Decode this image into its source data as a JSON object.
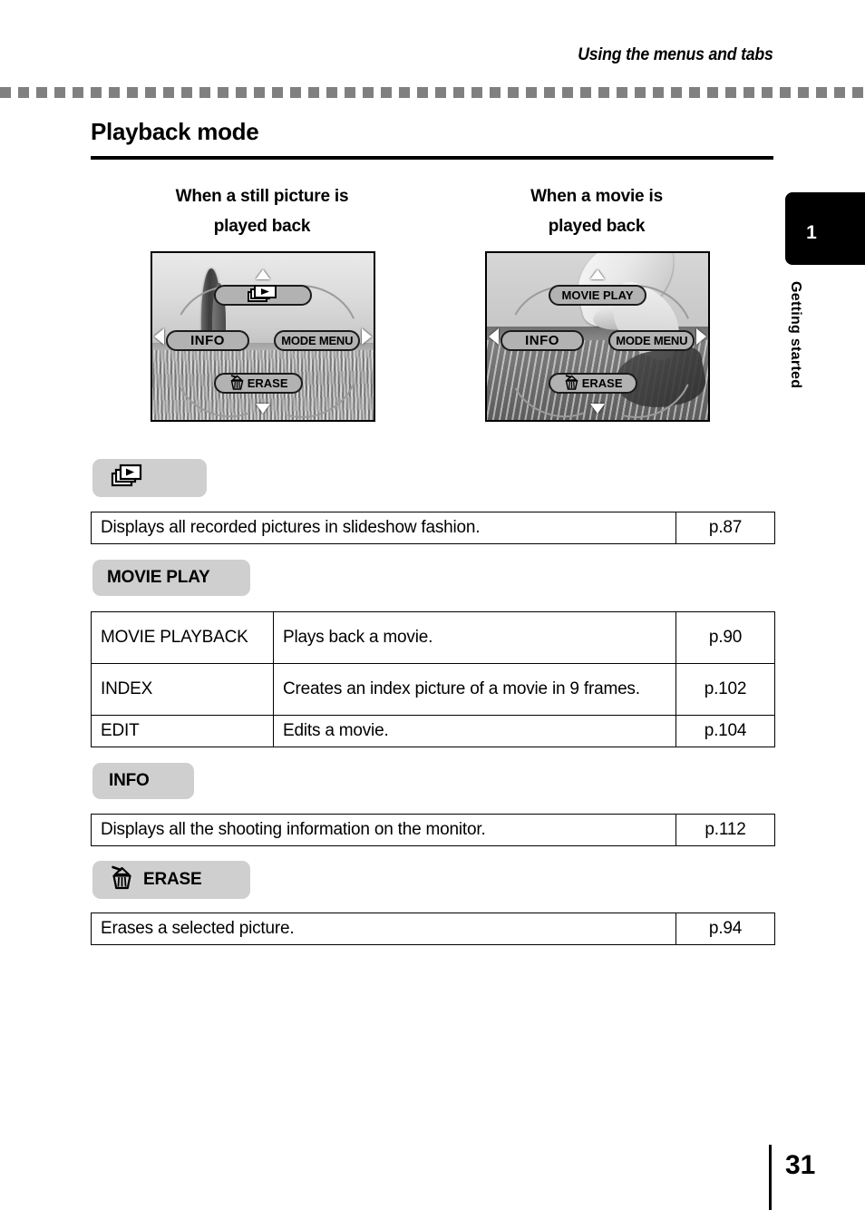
{
  "header": {
    "running_head": "Using the menus and tabs"
  },
  "page": {
    "section_title": "Playback mode",
    "number": "31"
  },
  "side_tab": {
    "chapter_number": "1",
    "chapter_label": "Getting started"
  },
  "screens": [
    {
      "caption_line1": "When a still picture is",
      "caption_line2": "played back",
      "photo_alt": "still picture of a tree in a field",
      "top_button": "",
      "top_button_icon": "slideshow-icon",
      "left_button": "INFO",
      "right_button": "MODE MENU",
      "bottom_button": "ERASE",
      "bottom_button_icon": "erase-trash-icon"
    },
    {
      "caption_line1": "When a movie is",
      "caption_line2": "played back",
      "photo_alt": "movie frame of a seagull over water",
      "top_button": "MOVIE PLAY",
      "top_button_icon": "",
      "left_button": "INFO",
      "right_button": "MODE MENU",
      "bottom_button": "ERASE",
      "bottom_button_icon": "erase-trash-icon"
    }
  ],
  "sections": [
    {
      "badge_label": "",
      "badge_icon": "slideshow-icon",
      "rows": [
        {
          "name": "",
          "desc": "Displays all recorded pictures in slideshow fashion.",
          "page": "p.87"
        }
      ]
    },
    {
      "badge_label": "MOVIE PLAY",
      "badge_icon": "",
      "rows": [
        {
          "name": "MOVIE PLAYBACK",
          "desc": "Plays back a movie.",
          "page": "p.90"
        },
        {
          "name": "INDEX",
          "desc": "Creates an index picture of a movie in 9 frames.",
          "page": "p.102"
        },
        {
          "name": "EDIT",
          "desc": "Edits a movie.",
          "page": "p.104"
        }
      ]
    },
    {
      "badge_label": "INFO",
      "badge_icon": "",
      "rows": [
        {
          "name": "",
          "desc": "Displays all the shooting information on the monitor.",
          "page": "p.112"
        }
      ]
    },
    {
      "badge_label": "ERASE",
      "badge_icon": "erase-trash-icon",
      "rows": [
        {
          "name": "",
          "desc": "Erases a selected picture.",
          "page": "p.94"
        }
      ]
    }
  ],
  "colors": {
    "dash_rule": "#808080",
    "badge_bg": "#cfcfcf",
    "tab_bg": "#000000",
    "pill_bg": "#b2b2b2"
  }
}
